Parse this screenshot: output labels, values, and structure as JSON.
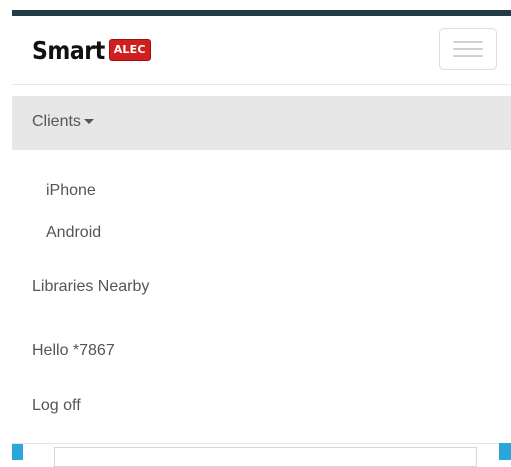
{
  "brand": {
    "name_part1": "Smart",
    "name_part2": "ALEC"
  },
  "navbar": {
    "toggle_icon": "hamburger-menu-icon"
  },
  "menu": {
    "clients_label": "Clients",
    "clients_items": [
      "iPhone",
      "Android"
    ],
    "libraries_label": "Libraries Nearby",
    "hello_label": "Hello *7867",
    "logoff_label": "Log off"
  },
  "colors": {
    "top_bar": "#243a44",
    "brand_badge": "#cf1f1f",
    "active_menu_bg": "#e7e7e7",
    "accent_blue": "#2aa6db"
  }
}
